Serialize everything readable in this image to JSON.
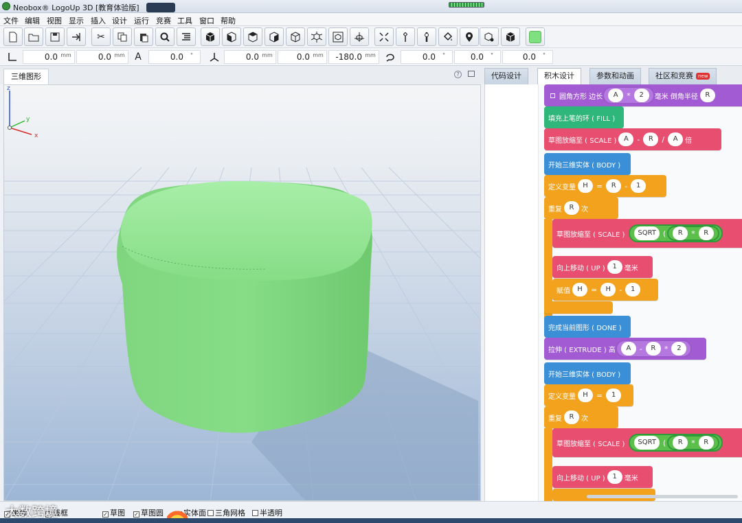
{
  "window": {
    "title": "Neobox® LogoUp 3D [教育体验版]"
  },
  "menu": [
    "文件",
    "编辑",
    "视图",
    "显示",
    "插入",
    "设计",
    "运行",
    "竞赛",
    "工具",
    "窗口",
    "帮助"
  ],
  "toolbar": {
    "icons": [
      "new-file-icon",
      "open-folder-icon",
      "save-icon",
      "export-icon",
      "cut-icon",
      "copy-icon",
      "paste-icon",
      "search-icon",
      "list-icon",
      "view-3d-icon",
      "view-front-icon",
      "view-top-icon",
      "view-right-icon",
      "view-iso-icon",
      "view-explode-icon",
      "view-frame-icon",
      "view-pivot-icon",
      "fit-icon",
      "pin-icon",
      "pin-bold-icon",
      "fill-icon",
      "location-icon",
      "box-gear-icon",
      "box-icon",
      "color-swatch"
    ],
    "current_color": "#7ee07e"
  },
  "coords": {
    "values": [
      "0.0",
      "0.0",
      "0.0",
      "0.0",
      "0.0",
      "-180.0",
      "0.0",
      "0.0",
      "0.0"
    ],
    "unit_mm": "mm",
    "unit_deg": "°"
  },
  "left_tab": {
    "label": "三维图形"
  },
  "right_tabs": [
    {
      "label": "代码设计"
    },
    {
      "label": "积木设计"
    },
    {
      "label": "参数和动画"
    },
    {
      "label": "社区和竞赛",
      "badge": "new"
    }
  ],
  "blocks": {
    "b1": {
      "label": "圆角方形 边长",
      "a": "A",
      "op": "*",
      "b": "2",
      "tail": "毫米 倒角半径",
      "c": "R"
    },
    "b2": {
      "label": "填充上笔的环 ( FILL )"
    },
    "b3": {
      "label": "草图放缩至 ( SCALE )",
      "a": "A",
      "op1": "-",
      "b": "R",
      "op2": "/",
      "c": "A",
      "tail": "倍"
    },
    "b4": {
      "label": "开始三维实体 ( BODY )"
    },
    "b5": {
      "label": "定义变量",
      "var": "H",
      "eq": "=",
      "a": "R",
      "op": "-",
      "b": "1"
    },
    "b6": {
      "label": "重复",
      "n": "R",
      "tail": "次"
    },
    "b7": {
      "label": "草图放缩至 ( SCALE )",
      "fn": "SQRT",
      "paren": "(",
      "a": "R",
      "op": "*",
      "b": "R"
    },
    "b8": {
      "label": "向上移动 ( UP )",
      "n": "1",
      "tail": "毫米"
    },
    "b9": {
      "label": "赋值",
      "var": "H",
      "eq": "=",
      "a": "H",
      "op": "-",
      "b": "1"
    },
    "b10": {
      "label": "完成当前图形 ( DONE )"
    },
    "b11": {
      "label": "拉伸 ( EXTRUDE ) 高",
      "a": "A",
      "op1": "-",
      "b": "R",
      "op2": "*",
      "c": "2"
    },
    "b12": {
      "label": "开始三维实体 ( BODY )"
    },
    "b13": {
      "label": "定义变量",
      "var": "H",
      "eq": "=",
      "a": "1"
    },
    "b14": {
      "label": "重复",
      "n": "R",
      "tail": "次"
    },
    "b15": {
      "label": "草图放缩至 ( SCALE )",
      "fn": "SQRT",
      "paren": "(",
      "a": "R",
      "op": "*",
      "b": "R"
    },
    "b16": {
      "label": "向上移动 ( UP )",
      "n": "1",
      "tail": "毫米"
    }
  },
  "status": {
    "items": [
      {
        "label": "坐标",
        "checked": true
      },
      {
        "label": "线框",
        "checked": true
      },
      {
        "label": "草图",
        "checked": true
      },
      {
        "label": "草图圆",
        "checked": true
      },
      {
        "label": "实体面",
        "checked": true
      },
      {
        "label": "三角网格",
        "checked": false
      },
      {
        "label": "半透明",
        "checked": false
      }
    ],
    "watermark": "大数跨境"
  },
  "axis_labels": {
    "x": "x",
    "y": "y",
    "z": "z"
  },
  "colors": {
    "model": "#86e086",
    "block_purple": "#a25bd3",
    "block_green": "#2fb67a",
    "block_pink": "#e84e70",
    "block_blue": "#3b8fd6",
    "block_orange": "#f2a21c"
  }
}
